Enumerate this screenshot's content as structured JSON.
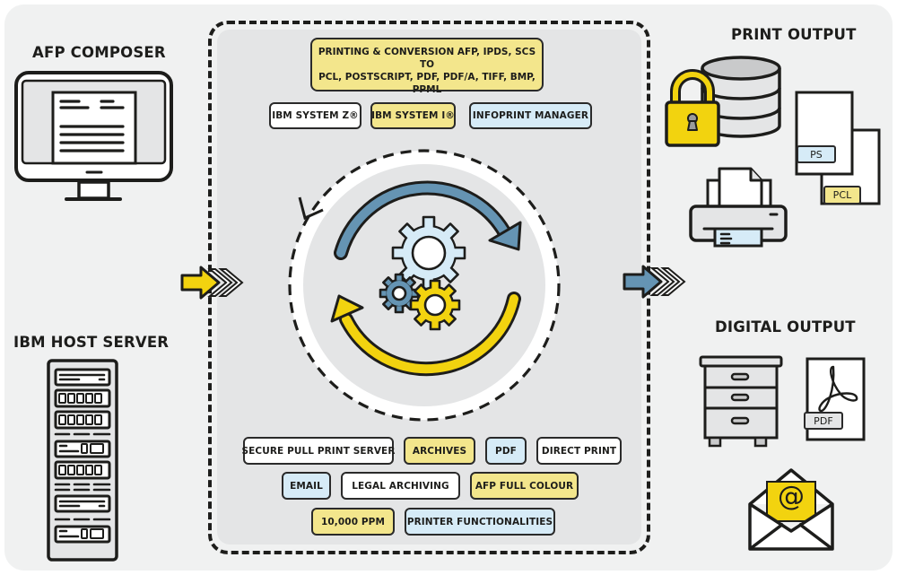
{
  "left": {
    "composer_title": "AFP COMPOSER",
    "server_title": "IBM HOST SERVER"
  },
  "center": {
    "conversion": {
      "line1": "PRINTING & CONVERSION AFP, IPDS, SCS",
      "line2": "TO",
      "line3": "PCL, POSTSCRIPT, PDF, PDF/A, TIFF, BMP, PPML"
    },
    "platforms": [
      {
        "label": "IBM SYSTEM Z®",
        "color": "white"
      },
      {
        "label": "IBM SYSTEM I®",
        "color": "yellow"
      },
      {
        "label": "INFOPRINT MANAGER",
        "color": "blue"
      }
    ],
    "features": [
      {
        "label": "SECURE PULL PRINT SERVER",
        "color": "white"
      },
      {
        "label": "ARCHIVES",
        "color": "yellow"
      },
      {
        "label": "PDF",
        "color": "blue"
      },
      {
        "label": "DIRECT PRINT",
        "color": "white"
      },
      {
        "label": "EMAIL",
        "color": "blue"
      },
      {
        "label": "LEGAL ARCHIVING",
        "color": "white"
      },
      {
        "label": "AFP FULL COLOUR",
        "color": "yellow"
      },
      {
        "label": "10,000 PPM",
        "color": "yellow"
      },
      {
        "label": "PRINTER FUNCTIONALITIES",
        "color": "blue"
      }
    ]
  },
  "right": {
    "print_title": "PRINT OUTPUT",
    "print_doc_labels": {
      "ps": "PS",
      "pcl": "PCL"
    },
    "digital_title": "DIGITAL OUTPUT",
    "digital_doc_label": "PDF",
    "email_symbol": "@"
  },
  "colors": {
    "yellow": "#f2d30f",
    "yellow_light": "#f3e68c",
    "blue": "#6594b3",
    "blue_light": "#d6ebf7",
    "outline": "#1d1d1b",
    "frame_bg": "#f0f1f1",
    "panel_bg": "#e4e5e6"
  },
  "icons": [
    "monitor-icon",
    "server-rack-icon",
    "input-arrow-icon",
    "output-arrow-icon",
    "cycle-arrows-icon",
    "gears-icon",
    "padlock-icon",
    "database-icon",
    "printer-icon",
    "documents-icon",
    "filing-cabinet-icon",
    "pdf-document-icon",
    "email-envelope-icon"
  ]
}
